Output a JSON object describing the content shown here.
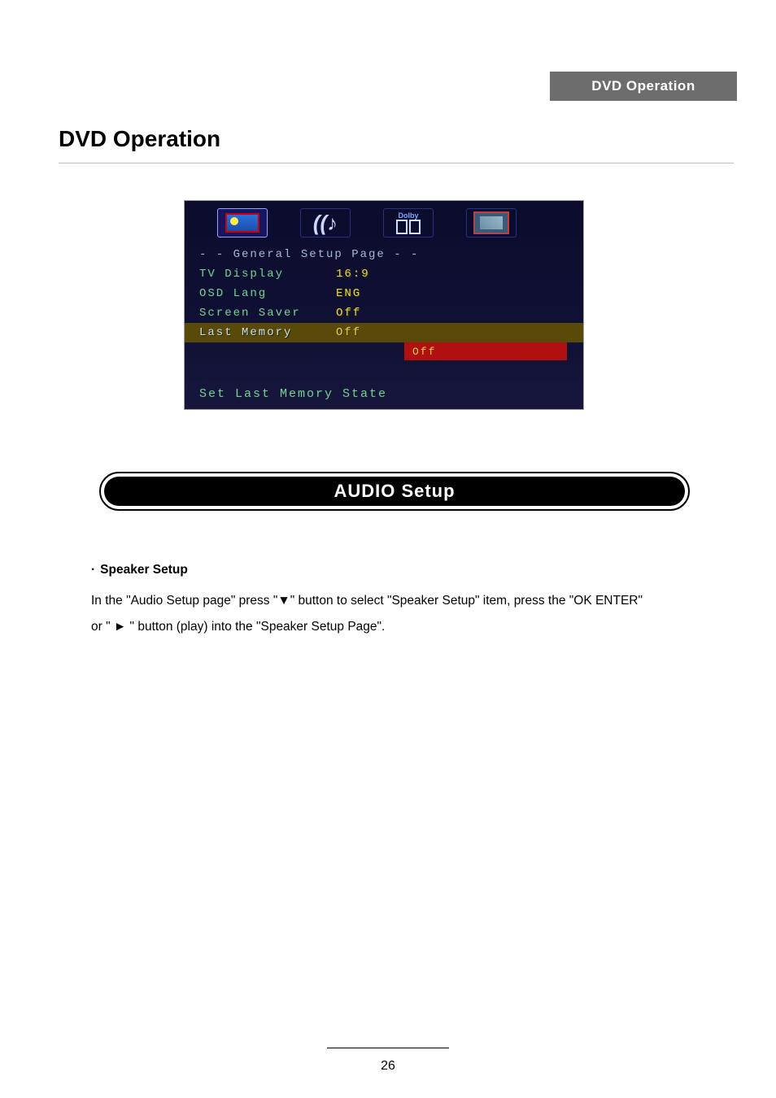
{
  "header_band": "DVD Operation",
  "main_title": "DVD Operation",
  "osd": {
    "tabs_dolby_label": "Dolby",
    "subtitle": "- -  General Setup Page  - -",
    "rows": [
      {
        "label": "TV Display",
        "value": "16:9"
      },
      {
        "label": "OSD Lang",
        "value": "ENG"
      },
      {
        "label": "Screen Saver",
        "value": "Off"
      },
      {
        "label": "Last Memory",
        "value": "Off"
      }
    ],
    "submenu_value": "Off",
    "footer": "Set Last Memory State"
  },
  "section_title": "AUDIO Setup",
  "body": {
    "bullet_label": "Speaker Setup",
    "line1_a": "In the \"Audio Setup page\" press \"",
    "line1_b": "\" button to select \"Speaker Setup\" item, press the \"OK ENTER\"",
    "line2_a": " or \" ",
    "line2_b": " \" button (play) into the \"Speaker Setup Page\".",
    "down_glyph": "▼",
    "right_glyph": "►"
  },
  "page_number": "26"
}
